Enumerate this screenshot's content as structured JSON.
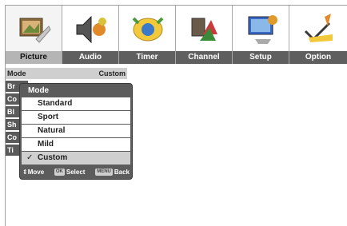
{
  "tabs": [
    {
      "label": "Picture",
      "icon": "picture-icon",
      "active": true
    },
    {
      "label": "Audio",
      "icon": "audio-icon",
      "active": false
    },
    {
      "label": "Timer",
      "icon": "timer-icon",
      "active": false
    },
    {
      "label": "Channel",
      "icon": "channel-icon",
      "active": false
    },
    {
      "label": "Setup",
      "icon": "setup-icon",
      "active": false
    },
    {
      "label": "Option",
      "icon": "option-icon",
      "active": false
    }
  ],
  "settings": {
    "mode_label": "Mode",
    "mode_value": "Custom",
    "rows_partial": [
      "Br",
      "Co",
      "Bl",
      "Sh",
      "Co",
      "Ti"
    ]
  },
  "popup": {
    "title": "Mode",
    "options": [
      "Standard",
      "Sport",
      "Natural",
      "Mild",
      "Custom"
    ],
    "selected": "Custom",
    "check_glyph": "✓",
    "footer": {
      "move_glyph": "⇕",
      "move": "Move",
      "select_key": "OK",
      "select": "Select",
      "back_key": "MENU",
      "back": "Back"
    }
  },
  "colors": {
    "tab_bar": "#5f5f5f",
    "tab_active": "#b5b5b5",
    "popup_bg": "#5c5c5c",
    "option_selected": "#cfcfcf"
  }
}
